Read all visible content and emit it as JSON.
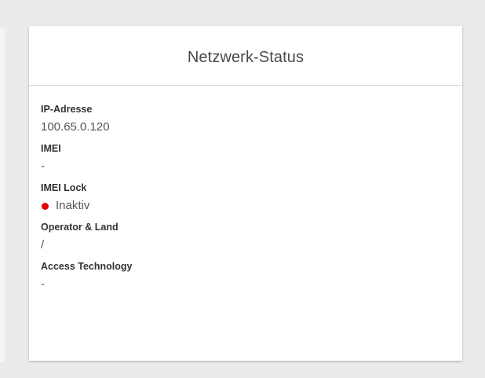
{
  "card": {
    "title": "Netzwerk-Status"
  },
  "fields": [
    {
      "label": "IP-Adresse",
      "value": "100.65.0.120"
    },
    {
      "label": "IMEI",
      "value": "-"
    },
    {
      "label": "IMEI Lock",
      "value": "Inaktiv",
      "status_color": "#e60000",
      "status_icon": "status-dot-icon"
    },
    {
      "label": "Operator & Land",
      "value": "/"
    },
    {
      "label": "Access Technology",
      "value": "-"
    }
  ]
}
